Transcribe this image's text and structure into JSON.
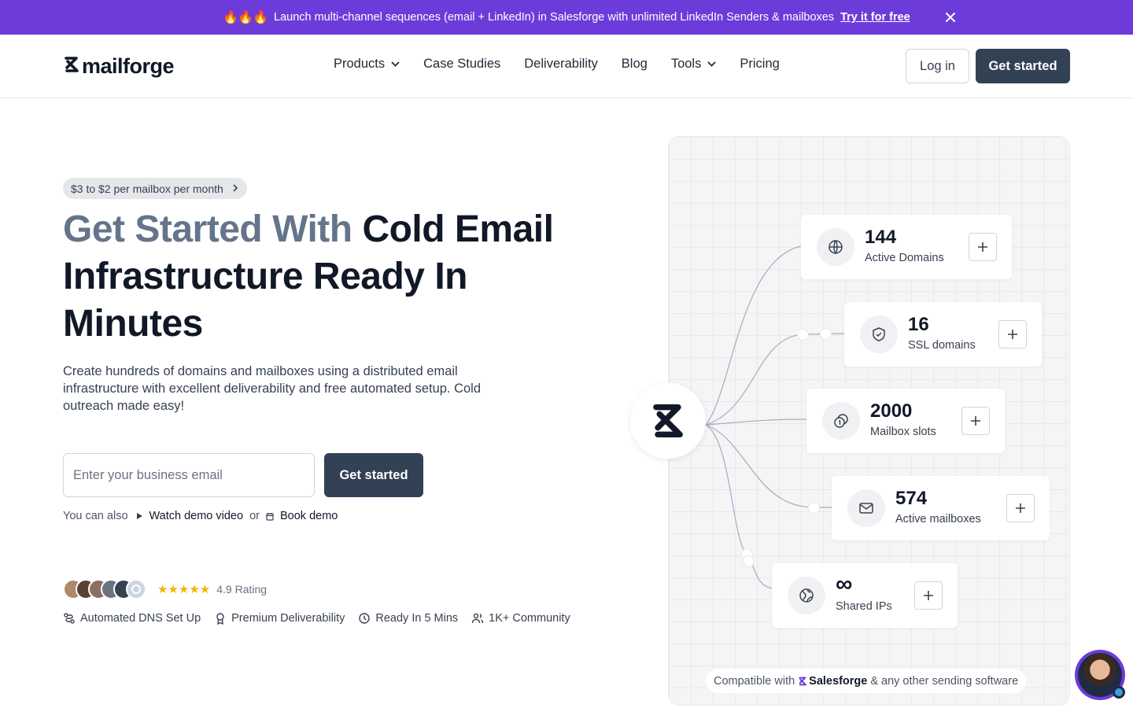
{
  "banner": {
    "flames": "🔥🔥🔥",
    "text": "Launch multi-channel sequences (email + LinkedIn) in Salesforge with unlimited LinkedIn Senders & mailboxes",
    "cta": "Try it for free"
  },
  "nav": {
    "logo": "mailforge",
    "items": [
      {
        "label": "Products",
        "dropdown": true
      },
      {
        "label": "Case Studies"
      },
      {
        "label": "Deliverability"
      },
      {
        "label": "Blog"
      },
      {
        "label": "Tools",
        "dropdown": true
      },
      {
        "label": "Pricing"
      }
    ],
    "login": "Log in",
    "get_started": "Get started"
  },
  "hero": {
    "pill": "$3 to $2 per mailbox per month",
    "headline_muted": "Get Started With",
    "headline_strong": "Cold Email Infrastructure Ready In Minutes",
    "subtext": "Create hundreds of domains and mailboxes using a distributed email infrastructure with excellent deliverability and free automated setup. Cold outreach made easy!",
    "email_placeholder": "Enter your business email",
    "cta": "Get started",
    "alt_prefix": "You can also",
    "watch_demo": "Watch demo video",
    "or": "or",
    "book_demo": "Book demo",
    "rating_stars": "★★★★★",
    "rating": "4.9 Rating",
    "features": [
      "Automated DNS Set Up",
      "Premium Deliverability",
      "Ready In 5 Mins",
      "1K+ Community"
    ]
  },
  "stats": [
    {
      "value": "144",
      "label": "Active Domains",
      "icon": "globe-icon"
    },
    {
      "value": "16",
      "label": "SSL domains",
      "icon": "shield-check-icon"
    },
    {
      "value": "2000",
      "label": "Mailbox slots",
      "icon": "coins-icon"
    },
    {
      "value": "574",
      "label": "Active mailboxes",
      "icon": "mail-icon"
    },
    {
      "value": "∞",
      "label": "Shared IPs",
      "icon": "network-globe-icon"
    }
  ],
  "compat": {
    "prefix": "Compatible with",
    "brand": "Salesforge",
    "suffix": "& any other sending software"
  },
  "colors": {
    "banner": "#6d3bd9",
    "primary_button": "#334155",
    "star": "#f5b301"
  }
}
